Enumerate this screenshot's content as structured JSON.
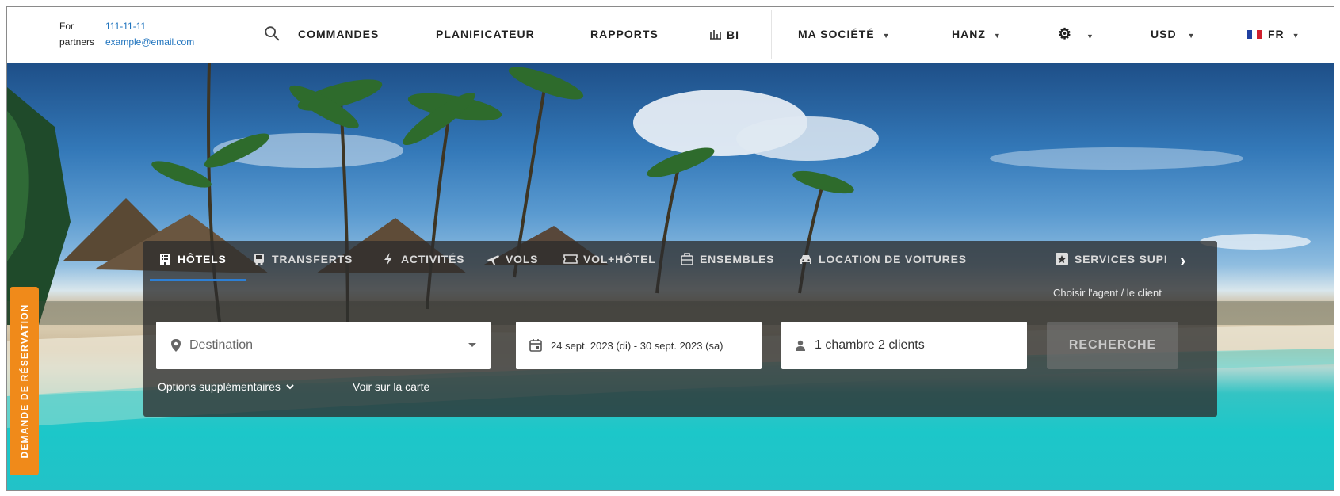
{
  "partners": {
    "phone_label": "For",
    "phone": "111-11-11",
    "email_label": "partners",
    "email": "example@email.com"
  },
  "nav": {
    "orders": "COMMANDES",
    "planner": "PLANIFICATEUR",
    "reports": "RAPPORTS",
    "bi": "BI",
    "company": "MA SOCIÉTÉ",
    "user": "HANZ",
    "currency": "USD",
    "language": "FR"
  },
  "side_tab": "DEMANDE DE RÉSERVATION",
  "tabs": [
    {
      "label": "HÔTELS",
      "icon": "building-icon"
    },
    {
      "label": "TRANSFERTS",
      "icon": "bus-icon"
    },
    {
      "label": "ACTIVITÉS",
      "icon": "bolt-icon"
    },
    {
      "label": "VOLS",
      "icon": "plane-icon"
    },
    {
      "label": "VOL+HÔTEL",
      "icon": "ticket-icon"
    },
    {
      "label": "ENSEMBLES",
      "icon": "suitcase-icon"
    },
    {
      "label": "LOCATION DE VOITURES",
      "icon": "car-icon"
    },
    {
      "label": "SERVICES SUPI",
      "icon": "star-box-icon"
    }
  ],
  "agent_link": "Choisir l'agent / le client",
  "search": {
    "destination_placeholder": "Destination",
    "dates": "24 sept. 2023 (di) -  30 sept. 2023 (sa)",
    "guests": "1 chambre 2 clients",
    "button": "RECHERCHE",
    "more_options": "Options supplémentaires",
    "map": "Voir sur la carte"
  },
  "colors": {
    "accent": "#2d7fd4",
    "side_tab": "#f08a1a",
    "link": "#1e73be"
  }
}
